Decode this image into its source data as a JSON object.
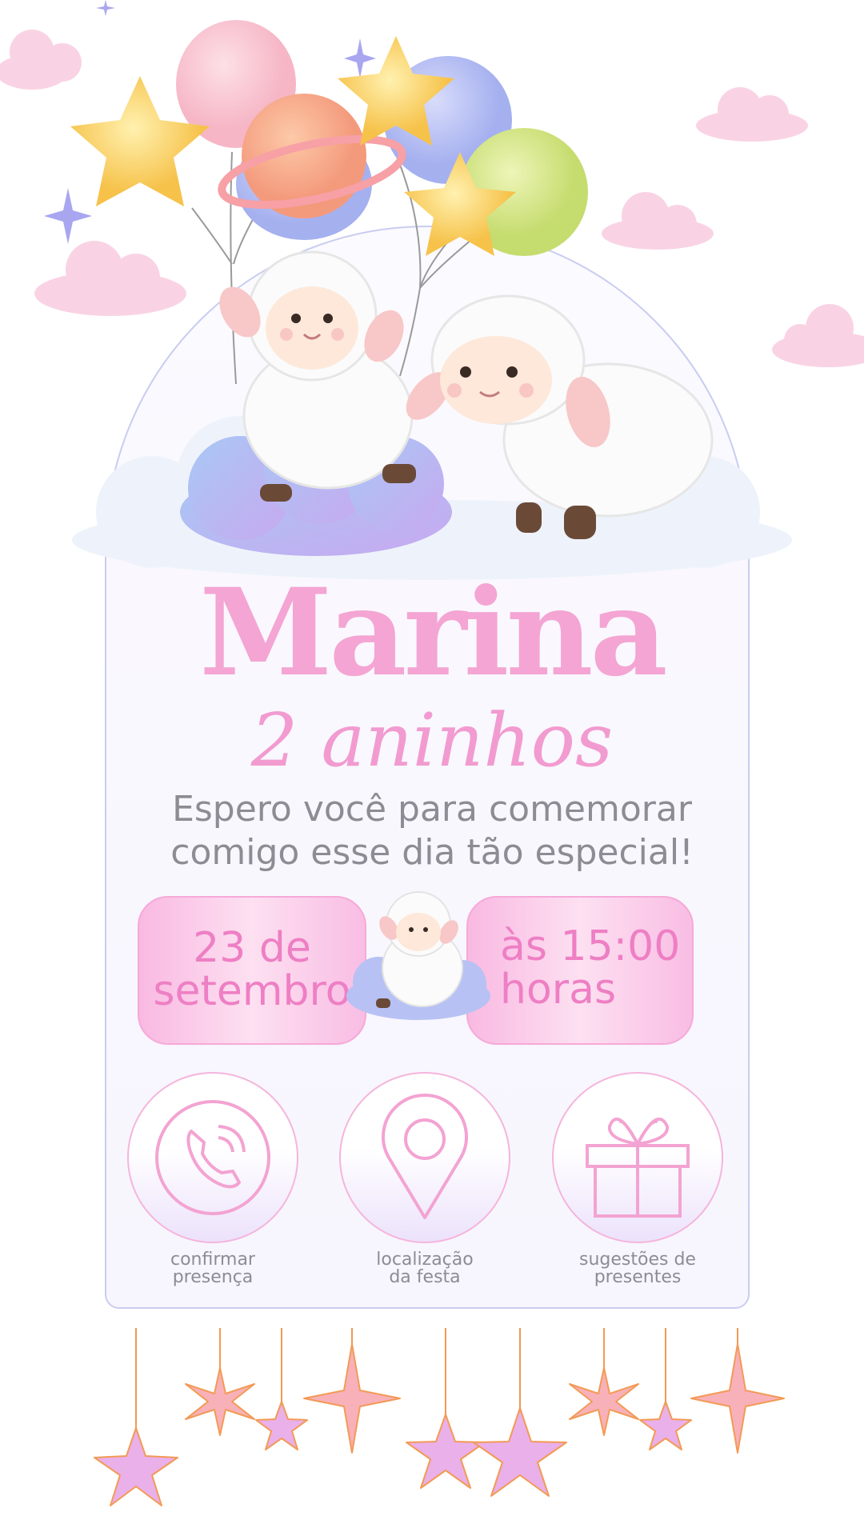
{
  "invite": {
    "name": "Marina",
    "age": "2 aninhos",
    "message": "Espero você para comemorar comigo esse dia tão especial!",
    "date": "23 de setembro",
    "time": "às 15:00 horas"
  },
  "actions": [
    {
      "label": "confirmar\npresença",
      "icon": "phone-icon"
    },
    {
      "label": "localização\nda festa",
      "icon": "location-pin-icon"
    },
    {
      "label": "sugestões de\npresentes",
      "icon": "gift-icon"
    }
  ],
  "colors": {
    "accent_pink": "#f4a5d3",
    "text_gray": "#8d8c95",
    "arch_border": "#c9cdf0",
    "pill_pink": "#f9b9e2"
  }
}
